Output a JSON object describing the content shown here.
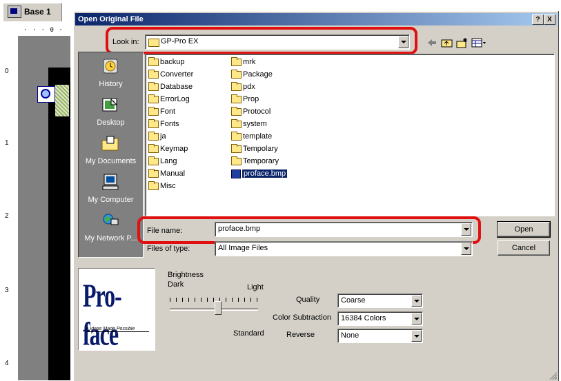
{
  "background_window": {
    "tab_label": "Base 1",
    "ruler_h_text": "· · · 0 · ·",
    "ruler_v_marks": [
      "0",
      "1",
      "2",
      "3",
      "4"
    ]
  },
  "dialog": {
    "title": "Open Original File",
    "help_button": "?",
    "close_button": "X",
    "look_in": {
      "label": "Look in:",
      "value": "GP-Pro EX"
    },
    "toolbar_icons": [
      "back-arrow-icon",
      "up-folder-icon",
      "new-folder-icon",
      "view-menu-icon"
    ],
    "places": [
      {
        "label": "History",
        "icon": "history-icon"
      },
      {
        "label": "Desktop",
        "icon": "desktop-icon"
      },
      {
        "label": "My Documents",
        "icon": "my-documents-icon"
      },
      {
        "label": "My Computer",
        "icon": "my-computer-icon"
      },
      {
        "label": "My Network P...",
        "icon": "my-network-places-icon"
      }
    ],
    "files_col1": [
      "backup",
      "Converter",
      "Database",
      "ErrorLog",
      "Font",
      "Fonts",
      "ja",
      "Keymap",
      "Lang",
      "Manual",
      "Misc"
    ],
    "files_col2": [
      "mrk",
      "Package",
      "pdx",
      "Prop",
      "Protocol",
      "system",
      "template",
      "Tempolary",
      "Temporary"
    ],
    "selected_file": "proface.bmp",
    "file_name": {
      "label": "File name:",
      "value": "proface.bmp"
    },
    "files_of_type": {
      "label": "Files of type:",
      "value": "All Image Files"
    },
    "open_button": "Open",
    "cancel_button": "Cancel",
    "preview": {
      "logo_text": "Pro-face",
      "tagline": "A Ideas Made Possible"
    },
    "brightness": {
      "label": "Brightness",
      "dark": "Dark",
      "light": "Light",
      "standard": "Standard",
      "level_fraction": 0.55
    },
    "quality": {
      "label": "Quality",
      "value": "Coarse"
    },
    "color_subtraction": {
      "label": "Color Subtraction",
      "value": "16384 Colors"
    },
    "reverse": {
      "label": "Reverse",
      "value": "None"
    }
  },
  "colors": {
    "title_start": "#0a246a",
    "title_end": "#a6caf0",
    "highlight": "#e01010",
    "selection": "#0a246a"
  }
}
